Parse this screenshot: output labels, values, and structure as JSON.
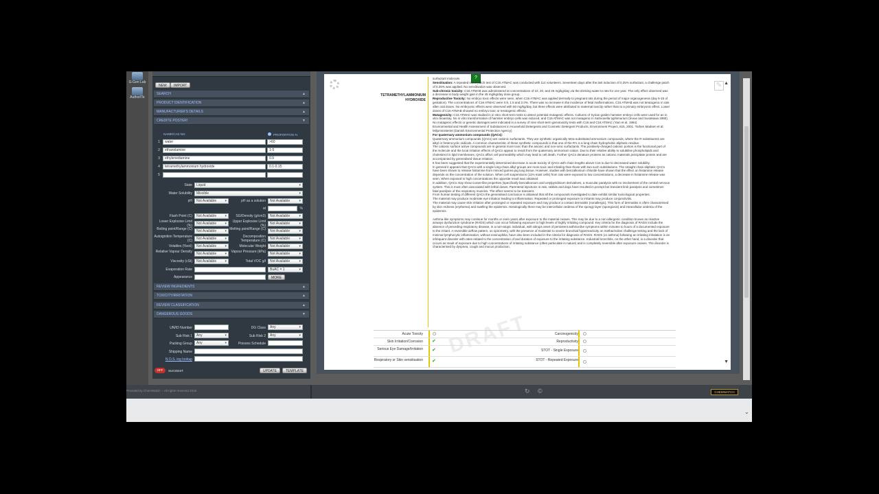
{
  "rail": {
    "lab_label": "G-Gen Lab",
    "author_label": "AuthorITe"
  },
  "left": {
    "new_label": "NEW",
    "import_label": "IMPORT",
    "sections_top": [
      "SEARCH",
      "PRODUCT IDENTIFICATION",
      "MANUFACTURER'S DETAILS",
      "CREDITE POSTER!"
    ],
    "col_name": "NAME/CAS NO.",
    "col_prop": "PROPORTION %",
    "ingredients": [
      {
        "n": "1",
        "name": "water",
        "prop": ">60"
      },
      {
        "n": "2",
        "name": "ethanolamine",
        "prop": "1-5"
      },
      {
        "n": "3",
        "name": "ethylenediamine",
        "prop": "0.9"
      },
      {
        "n": "4",
        "name": "tetramethylammonium hydroxide",
        "prop": "0.1-0.15"
      },
      {
        "n": "5",
        "name": "",
        "prop": ""
      }
    ],
    "state_label": "State",
    "state_value": "Liquid",
    "water_label": "Water Solubility",
    "water_value": "Miscible",
    "ph_label": "pH",
    "ph_value": "Not Available",
    "ph_sol_label": "pH as a solution",
    "ph_sol_value": "Not Available",
    "at_label": "at",
    "pct_label": "%",
    "props": [
      {
        "l": "Flash Point (C)",
        "v": "Not Available",
        "l2": "SG/Density (g/cm3)",
        "v2": "Not Available"
      },
      {
        "l": "Lower Explosive Limit (%)",
        "v": "Not Available",
        "l2": "Upper Explosive Limit (%)",
        "v2": "Not Available"
      },
      {
        "l": "Boiling point/Range (C)",
        "v": "Not Available",
        "l2": "Melting point/Range (C)",
        "v2": "Not Available"
      },
      {
        "l": "Autoignition Temperature (C)",
        "v": "Not Available",
        "l2": "Decomposition Temperature (C)",
        "v2": "Not Available"
      },
      {
        "l": "Volatiles (%vol)",
        "v": "Not Available",
        "l2": "Molecular Weight",
        "v2": "Not Available"
      },
      {
        "l": "Relative Vapour Density",
        "v": "Not Available",
        "l2": "Vapour Pressure (kPa)",
        "v2": "Not Available"
      },
      {
        "l": "Viscosity (cSt)",
        "v": "Not Available",
        "l2": "Total VOC g/l",
        "v2": "Not Available"
      }
    ],
    "evap_label": "Evaporation Rate",
    "evap_value": "",
    "evap_sel": "BuAC = 1",
    "appearance_label": "Appearance",
    "more_label": "MORE",
    "sections_mid": [
      "REVIEW INGREDIENTS",
      "TOXICITY/IRRITATION",
      "REVIEW CLASSIFICATION",
      "DANGEROUS GOODS"
    ],
    "dg": {
      "unid_label": "UN/ID Number",
      "dg_class_label": "DG Class",
      "dg_class_value": "Any",
      "sub1_label": "Sub Risk 1",
      "sub1_value": "Any",
      "sub2_label": "Sub Risk 2",
      "sub2_value": "Any",
      "pack_label": "Packing Group",
      "pack_value": "Any",
      "poison_label": "Poisons Schedule",
      "ship_label": "Shipping Name",
      "nos_label": "N.O.S. ing lookup"
    },
    "off_label": "OFF",
    "suggest_label": "SUGGEST",
    "update_label": "UPDATE",
    "template_label": "TEMPLATE"
  },
  "doc": {
    "substance": "TETRAMETHYLAMMONIUM HYDROXIDE",
    "green_badge": "?",
    "paragraphs": [
      {
        "bold": "",
        "text": "surfactant molecule."
      },
      {
        "bold": "Sensitisation:",
        "text": " A repeated insult patch test of C16 ATMAC was conducted with 114 volunteers. Seventeen days after the last induction of 0.25% surfactant, a challenge patch of 0.25% was applied. No sensitisation was observed."
      },
      {
        "bold": "Sub-chronic toxicity:",
        "text": " C16 ATMAB was administered at concentrations of 10, 20, and 45 mg/kg/day via the drinking water to rats for one year. The only effect observed was a decrease in body weight gain in the 45 mg/kg/day dose group."
      },
      {
        "bold": "Reproductive Toxicity:",
        "text": " No embryo toxic effects were seen, when C16 ATMAC was applied dermally to pregnant rats during the period of major organogenesis (day 6-15 of gestation). The concentrations of C16 ATMAC were 0.9, 1.5 and 2.0%. There was no increase in the incidence of fetal malformations. C16 ATMAB was not teratogenic in rats after oral doses. No embryonic effects were observed with 50 mg/kg/day, but three effects were attributed to maternal toxicity rather than to a primary embryonic effect. Lower doses of C16 ATMAB showed no embryo toxic or teratogenic effects."
      },
      {
        "bold": "Mutagenicity:",
        "text": " C16 ATMAC was studied in in vitro short-term tests to detect potential mutagenic effects. Cultures of Syrian golden hamster embryo cells were used for an in vitro bioassay. No in vitro transformation of hamster embryo cells was induced, and C16 ATMAC was not mutagenic in Salmonella typhimurium (Inoue and Sunakawa 1980). No mutagenic effects or genetic damages were indicated in a survey of nine short-term genotoxicity tests with C16 and C18 ATMAC (Yam et al. 1984)."
      },
      {
        "bold": "",
        "text": "Environmental and Health Assessment of Substances in Household Detergents and Cosmetic Detergent Products, Environment Project, 615, 2001. Torben Madsen et al: Miljoministeriet (Danish Environmental Protection Agency)"
      },
      {
        "bold": "For quaternary ammonium compounds (QACs):",
        "text": ""
      },
      {
        "bold": "",
        "text": "Quaternary ammonium compounds (QACs) are cationic surfactants. They are synthetic organically tetra-substituted ammonium compounds, where the R substituents are alkyl or heterocyclic radicals. A common characteristic of these synthetic compounds is that one of the R's is a long-chain hydrophobic aliphatic residue."
      },
      {
        "bold": "",
        "text": "The cationic surface active compounds are in general more toxic than the anionic and non-ionic surfactants. The positively-charged cationic portion is the functional part of the molecule and the local irritation effects of QACs appear to result from the quaternary ammonium cation. Due to their relative ability to solubilise phospholipids and cholesterol in lipid membranes, QACs affect cell permeability which may lead to cell death. Further QACs denature proteins as cationic materials precipitate protein and are accompanied by generalised tissue irritation."
      },
      {
        "bold": "",
        "text": "It has been suggested that the experimentally determined decrease in acute toxicity of QACs with chain lengths above C16 is due to decreased water solubility."
      },
      {
        "bold": "",
        "text": "In general it appears that QACs with a single long-chain alkyl groups are more toxic and irritating than those with two such substitutions. The straight chain aliphatic QACs have been shown to release histamine from minced guinea pig lung tissue. However, studies with benzalkonium chloride have shown that the effect on histamine release depends on the concentration of the solution. When cell suspensions (11% mast cells) from rats were exposed to low concentrations, a decrease in histamine release was seen. When exposed to high concentrations the opposite result was obtained."
      },
      {
        "bold": "",
        "text": "In addition, QACs may show curare-like properties (specifically benzalkonium and cetylpyridinium derivatives, a muscular paralysis with no involvement of the central nervous system. This is most often associated with lethal doses. Parenteral injections in rats, rabbits and dogs have resulted in prompt but transient limb paralysis and sometimes fatal paralysis of the respiratory muscles. The effect seems to be transient."
      },
      {
        "bold": "",
        "text": "From human testing of different QACs the generalised conclusion is obtained that all the compounds investigated to date exhibit similar toxicological properties."
      },
      {
        "bold": "",
        "text": "The material may produce moderate eye irritation leading to inflammation. Repeated or prolonged exposure to irritants may produce conjunctivitis."
      },
      {
        "bold": "",
        "text": "The material may cause skin irritation after prolonged or repeated exposure and may produce a contact dermatitis (nonallergic). This form of dermatitis is often characterised by skin redness (erythema) and swelling the epidermis. Histologically there may be intercellular oedema of the spongy layer (spongiosis) and intracellular oedema of the epidermis."
      },
      {
        "bold": "",
        "text": " "
      },
      {
        "bold": "",
        "text": "Asthma-like symptoms may continue for months or even years after exposure to the material ceases. This may be due to a non-allergenic condition known as reactive airways dysfunction syndrome (RADS) which can occur following exposure to high levels of highly irritating compound. Key criteria for the diagnosis of RADS include the absence of preceding respiratory disease, in a non-atopic individual, with abrupt onset of persistent asthma-like symptoms within minutes to hours of a documented exposure to the irritant. A reversible airflow pattern, on spirometry, with the presence of moderate to severe bronchial hyperreactivity on methacholine challenge testing and the lack of minimal lymphocytic inflammation, without eosinophilia, have also been included in the criteria for diagnosis of RADS. RADS (or asthma) following an irritating inhalation is an infrequent disorder with rates related to the concentration of and duration of exposure to the irritating substance. Industrial bronchitis, on the other hand, is a disorder that occurs as result of exposure due to high concentrations of irritating substance (often particulate in nature) and is completely reversible after exposure ceases. The disorder is characterised by dyspnea, cough and mucus production."
      }
    ],
    "watermark": "DRAFT",
    "hazards": [
      {
        "l": "Acute Toxicity",
        "lv": "none",
        "r": "Carcinogenicity",
        "rv": "none"
      },
      {
        "l": "Skin Irritation/Corrosion",
        "lv": "tick",
        "r": "Reproductivity",
        "rv": "none"
      },
      {
        "l": "Serious Eye Damage/Irritation",
        "lv": "tick",
        "r": "STOT - Single Exposure",
        "rv": "none"
      },
      {
        "l": "Respiratory or Skin sensitisation",
        "lv": "tick",
        "r": "STOT - Repeated Exposure",
        "rv": "none"
      }
    ]
  },
  "footer": {
    "copyright": "Provided by ChemWatch -- All rights reserved 2015",
    "brand": "CHEMWATCH"
  }
}
